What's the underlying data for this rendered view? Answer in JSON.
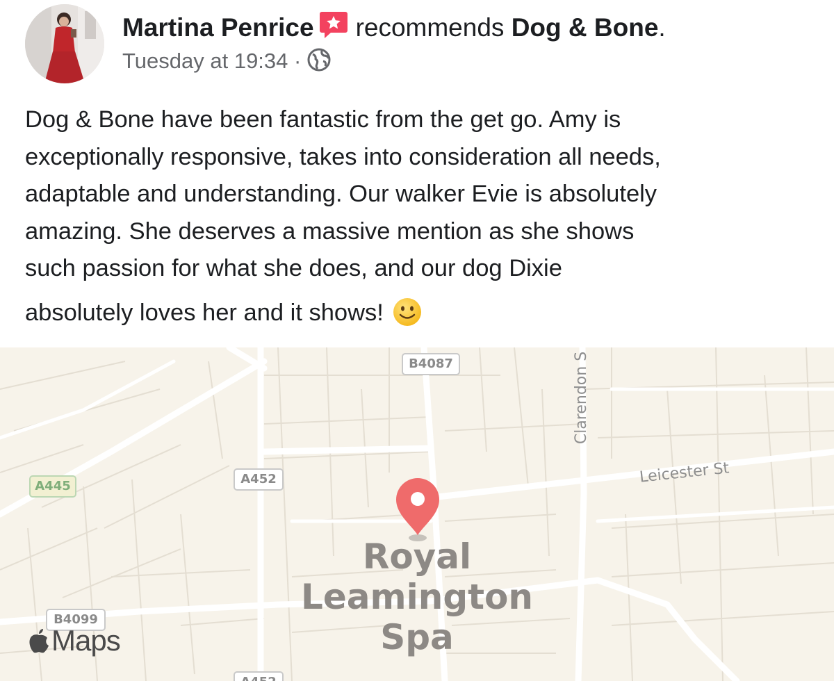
{
  "post": {
    "author_name": "Martina Penrice",
    "action_text": "recommends",
    "page_name": "Dog & Bone",
    "page_suffix": ".",
    "timestamp": "Tuesday at 19:34",
    "separator": "·",
    "audience_icon": "globe-icon",
    "recommend_icon": "recommend-star-icon",
    "recommend_color": "#f3425f",
    "text_lines": [
      "Dog & Bone have been fantastic from the get go. Amy is",
      "exceptionally responsive, takes into consideration all needs,",
      "adaptable and understanding. Our walker Evie is absolutely",
      "amazing. She deserves a massive mention as she shows",
      "such passion for what she does, and our dog Dixie",
      "absolutely loves her and it shows!"
    ],
    "emoji": "slightly-smiling-face-icon"
  },
  "map": {
    "road_labels": {
      "b4087": "B4087",
      "a452": "A452",
      "a445": "A445",
      "b4099": "B4099",
      "a452_bottom": "A452"
    },
    "streets": {
      "clarendon": "Clarendon S",
      "leicester": "Leicester St"
    },
    "city": [
      "Royal",
      "Leamington",
      "Spa"
    ],
    "pin_icon": "location-pin-icon",
    "pin_color": "#ef6b6b",
    "logo_text": "Maps",
    "logo_icon": "apple-icon"
  }
}
